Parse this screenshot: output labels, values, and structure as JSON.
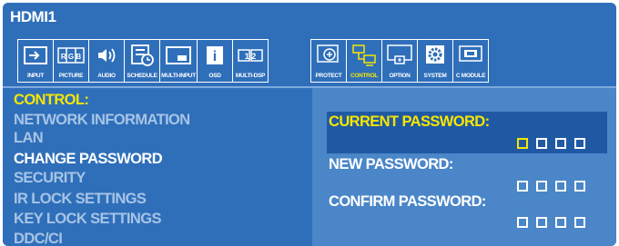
{
  "window": {
    "title": "HDMI1"
  },
  "toolbar": {
    "items": [
      {
        "label": "INPUT",
        "icon": "input-icon"
      },
      {
        "label": "PICTURE",
        "icon": "picture-icon"
      },
      {
        "label": "AUDIO",
        "icon": "audio-icon"
      },
      {
        "label": "SCHEDULE",
        "icon": "schedule-icon"
      },
      {
        "label": "MULTI-INPUT",
        "icon": "multi-input-icon"
      },
      {
        "label": "OSD",
        "icon": "osd-icon"
      },
      {
        "label": "MULTI-DSP",
        "icon": "multi-display-icon"
      },
      {
        "label": "PROTECT",
        "icon": "protect-icon"
      },
      {
        "label": "CONTROL",
        "icon": "control-icon",
        "active": true
      },
      {
        "label": "OPTION",
        "icon": "option-icon"
      },
      {
        "label": "SYSTEM",
        "icon": "system-icon"
      },
      {
        "label": "C MODULE",
        "icon": "compute-module-icon"
      }
    ],
    "picture_glyphs": "R G B",
    "multi_dsp_glyphs": "1 2",
    "osd_glyph": "i"
  },
  "menu": {
    "heading": "CONTROL:",
    "items": [
      {
        "label": "NETWORK INFORMATION"
      },
      {
        "label": "LAN"
      },
      {
        "label": "CHANGE PASSWORD",
        "selected": true
      },
      {
        "label": "SECURITY"
      },
      {
        "label": "IR LOCK SETTINGS"
      },
      {
        "label": "KEY LOCK SETTINGS"
      },
      {
        "label": "DDC/CI"
      }
    ]
  },
  "panel": {
    "current_password_label": "CURRENT PASSWORD:",
    "new_password_label": "NEW PASSWORD:",
    "confirm_password_label": "CONFIRM PASSWORD:",
    "digits_per_field": 4,
    "active_field": "current",
    "active_digit": 1
  },
  "colors": {
    "background": "#2f6fba",
    "panel": "#4a86c8",
    "highlight_row": "#2059a3",
    "accent_yellow": "#f7e600",
    "dim_text": "#a7c4e6",
    "text": "#ffffff"
  }
}
